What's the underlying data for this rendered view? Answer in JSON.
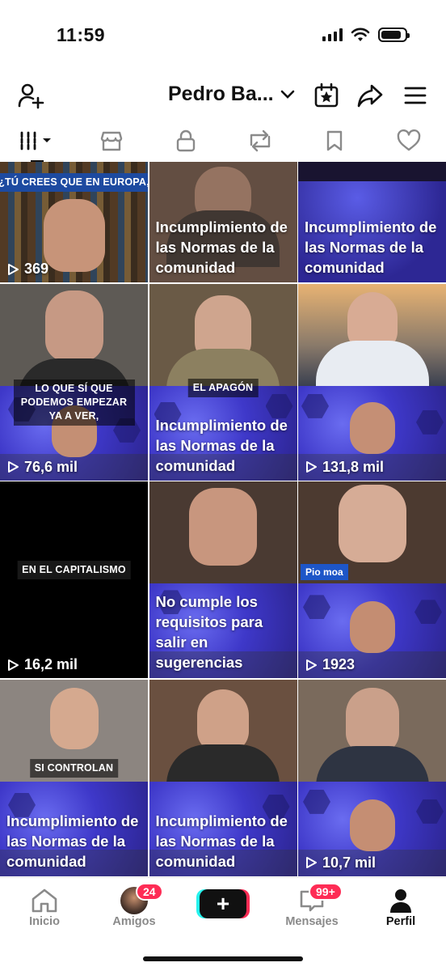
{
  "status_bar": {
    "time": "11:59"
  },
  "header": {
    "username": "Pedro Ba..."
  },
  "tabs": [
    {
      "name": "videos",
      "icon": "grid-icon",
      "active": true
    },
    {
      "name": "shop",
      "icon": "shop-icon",
      "active": false
    },
    {
      "name": "private",
      "icon": "lock-icon",
      "active": false
    },
    {
      "name": "reposts",
      "icon": "repost-icon",
      "active": false
    },
    {
      "name": "favorites",
      "icon": "bookmark-icon",
      "active": false
    },
    {
      "name": "liked",
      "icon": "heart-icon",
      "active": false
    }
  ],
  "grid": {
    "c1": {
      "caption": "¿TÚ CREES QUE EN EUROPA,",
      "views": "369"
    },
    "c2": {
      "notice": "Incumplimiento de las Normas de la comunidad"
    },
    "c3": {
      "notice": "Incumplimiento de las Normas de la comunidad"
    },
    "c4": {
      "caption": "LO QUE SÍ QUE PODEMOS EMPEZAR YA A VER,",
      "views": "76,6 mil"
    },
    "c5": {
      "caption": "EL APAGÓN",
      "notice": "Incumplimiento de las Normas de la comunidad"
    },
    "c6": {
      "views": "131,8 mil"
    },
    "c7": {
      "caption": "EN EL CAPITALISMO",
      "views": "16,2 mil"
    },
    "c8": {
      "notice": "No cumple los requisitos para salir en sugerencias"
    },
    "c9": {
      "label": "Pio moa",
      "views": "1923"
    },
    "c10": {
      "caption": "SI CONTROLAN",
      "notice": "Incumplimiento de las Normas de la comunidad"
    },
    "c11": {
      "notice": "Incumplimiento de las Normas de la comunidad"
    },
    "c12": {
      "views": "10,7 mil"
    }
  },
  "bottom_nav": {
    "home": "Inicio",
    "friends": "Amigos",
    "friends_badge": "24",
    "create": "+",
    "inbox": "Mensajes",
    "inbox_badge": "99+",
    "profile": "Perfil"
  },
  "colors": {
    "accent_pink": "#fe2c55",
    "accent_cyan": "#25f4ee",
    "video_bg_blue": "#3e38c9"
  }
}
